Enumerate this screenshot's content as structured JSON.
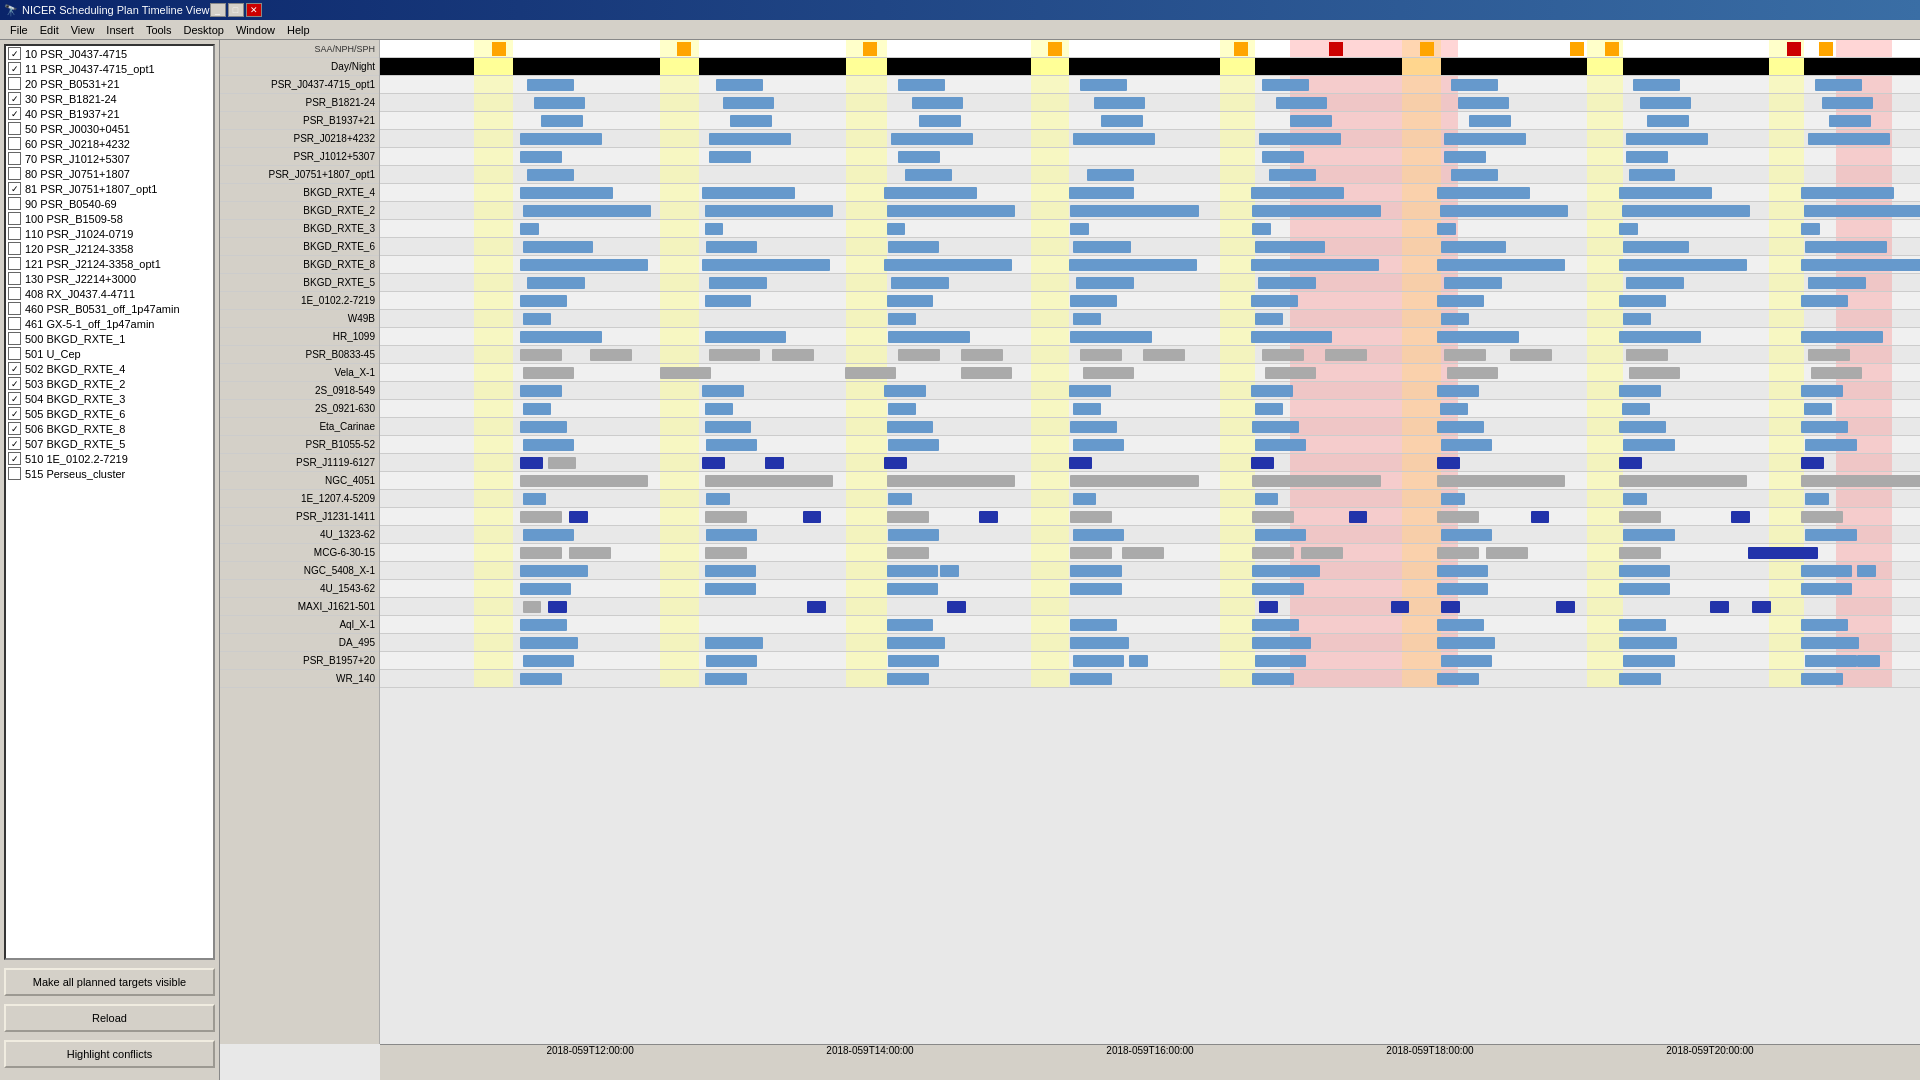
{
  "window": {
    "title": "NICER Scheduling Plan Timeline View"
  },
  "menubar": {
    "items": [
      "File",
      "Edit",
      "View",
      "Insert",
      "Tools",
      "Desktop",
      "Window",
      "Help"
    ]
  },
  "left_panel": {
    "targets": [
      {
        "id": "10",
        "name": "PSR_J0437-4715",
        "checked": true
      },
      {
        "id": "11",
        "name": "PSR_J0437-4715_opt1",
        "checked": true
      },
      {
        "id": "20",
        "name": "PSR_B0531+21",
        "checked": false
      },
      {
        "id": "30",
        "name": "PSR_B1821-24",
        "checked": true
      },
      {
        "id": "40",
        "name": "PSR_B1937+21",
        "checked": true
      },
      {
        "id": "50",
        "name": "PSR_J0030+0451",
        "checked": false
      },
      {
        "id": "60",
        "name": "PSR_J0218+4232",
        "checked": false
      },
      {
        "id": "70",
        "name": "PSR_J1012+5307",
        "checked": false
      },
      {
        "id": "80",
        "name": "PSR_J0751+1807",
        "checked": false
      },
      {
        "id": "81",
        "name": "PSR_J0751+1807_opt1",
        "checked": true
      },
      {
        "id": "90",
        "name": "PSR_B0540-69",
        "checked": false
      },
      {
        "id": "100",
        "name": "PSR_B1509-58",
        "checked": false
      },
      {
        "id": "110",
        "name": "PSR_J1024-0719",
        "checked": false
      },
      {
        "id": "120",
        "name": "PSR_J2124-3358",
        "checked": false
      },
      {
        "id": "121",
        "name": "PSR_J2124-3358_opt1",
        "checked": false
      },
      {
        "id": "130",
        "name": "PSR_J2214+3000",
        "checked": false
      },
      {
        "id": "408",
        "name": "RX_J0437.4-4711",
        "checked": false
      },
      {
        "id": "460",
        "name": "PSR_B0531_off_1p47amin",
        "checked": false
      },
      {
        "id": "461",
        "name": "GX-5-1_off_1p47amin",
        "checked": false
      },
      {
        "id": "500",
        "name": "BKGD_RXTE_1",
        "checked": false
      },
      {
        "id": "501",
        "name": "U_Cep",
        "checked": false
      },
      {
        "id": "502",
        "name": "BKGD_RXTE_4",
        "checked": true
      },
      {
        "id": "503",
        "name": "BKGD_RXTE_2",
        "checked": true
      },
      {
        "id": "504",
        "name": "BKGD_RXTE_3",
        "checked": true
      },
      {
        "id": "505",
        "name": "BKGD_RXTE_6",
        "checked": true
      },
      {
        "id": "506",
        "name": "BKGD_RXTE_8",
        "checked": true
      },
      {
        "id": "507",
        "name": "BKGD_RXTE_5",
        "checked": true
      },
      {
        "id": "510",
        "name": "1E_0102.2-7219",
        "checked": true
      },
      {
        "id": "515",
        "name": "Perseus_cluster",
        "checked": false
      }
    ],
    "buttons": {
      "make_visible": "Make all planned targets visible",
      "reload": "Reload",
      "highlight_conflicts": "Highlight conflicts"
    }
  },
  "timeline": {
    "rows": [
      "SAA/NPH/SPH",
      "Day/Night",
      "PSR_J0437-4715_opt1",
      "PSR_B1821-24",
      "PSR_B1937+21",
      "PSR_J0218+4232",
      "PSR_J1012+5307",
      "PSR_J0751+1807_opt1",
      "BKGD_RXTE_4",
      "BKGD_RXTE_2",
      "BKGD_RXTE_3",
      "BKGD_RXTE_6",
      "BKGD_RXTE_8",
      "BKGD_RXTE_5",
      "1E_0102.2-7219",
      "W49B",
      "HR_1099",
      "PSR_B0833-45",
      "Vela_X-1",
      "2S_0918-549",
      "2S_0921-630",
      "Eta_Carinae",
      "PSR_B1055-52",
      "PSR_J1119-6127",
      "NGC_4051",
      "1E_1207.4-5209",
      "PSR_J1231-1411",
      "4U_1323-62",
      "MCG-6-30-15",
      "NGC_5408_X-1",
      "4U_1543-62",
      "MAXI_J1621-501",
      "Aql_X-1",
      "DA_495",
      "PSR_B1957+20",
      "WR_140"
    ],
    "time_labels": [
      "2018-059T12:00:00",
      "2018-059T14:00:00",
      "2018-059T16:00:00",
      "2018-059T18:00:00",
      "2018-059T20:00:00"
    ],
    "colors": {
      "accent": "#0a246a",
      "saa_yellow": "#ffa500",
      "saa_red": "#cc0000",
      "obs_blue": "#6699cc",
      "obs_gray": "#aaaaaa",
      "obs_dark_blue": "#1122aa",
      "conflict_pink": "rgba(255,120,120,0.3)",
      "saa_highlight": "rgba(255,255,180,0.6)"
    }
  }
}
